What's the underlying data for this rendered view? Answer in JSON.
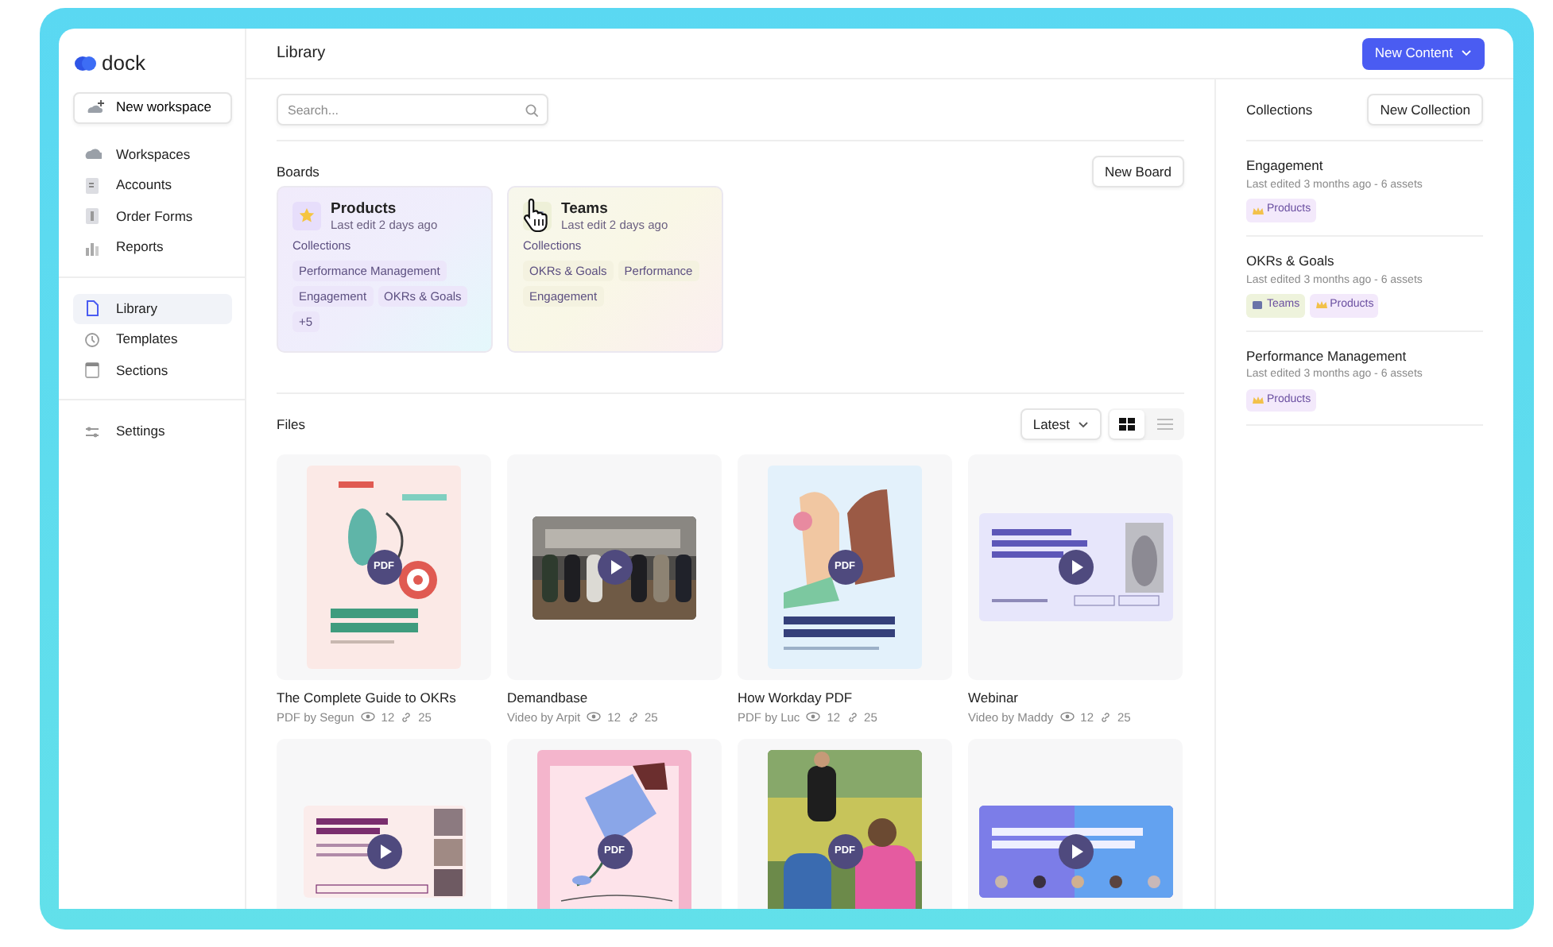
{
  "sidebar": {
    "logo": "dock",
    "new_workspace": "New workspace",
    "groups": [
      [
        {
          "label": "Workspaces",
          "kind": "workspaces",
          "selected": false
        },
        {
          "label": "Accounts",
          "kind": "accounts",
          "selected": false
        },
        {
          "label": "Order Forms",
          "kind": "orders",
          "selected": false
        },
        {
          "label": "Reports",
          "kind": "reports",
          "selected": false
        }
      ],
      [
        {
          "label": "Library",
          "kind": "library",
          "selected": true
        },
        {
          "label": "Templates",
          "kind": "templates",
          "selected": false
        },
        {
          "label": "Sections",
          "kind": "sections",
          "selected": false
        }
      ],
      [
        {
          "label": "Settings",
          "kind": "settings",
          "selected": false
        }
      ]
    ]
  },
  "header": {
    "title": "Library",
    "new_content": "New Content"
  },
  "search": {
    "placeholder": "Search..."
  },
  "boards": {
    "title": "Boards",
    "new_board": "New Board",
    "items": [
      {
        "kind": "products",
        "name": "Products",
        "meta": "Last edit 2 days ago",
        "collections_label": "Collections",
        "tags": [
          "Performance Management",
          "Engagement",
          "OKRs & Goals",
          "+5"
        ]
      },
      {
        "kind": "teams",
        "name": "Teams",
        "meta": "Last edit 2 days ago",
        "collections_label": "Collections",
        "tags": [
          "OKRs & Goals",
          "Performance",
          "Engagement"
        ]
      }
    ]
  },
  "files": {
    "title": "Files",
    "sort": "Latest",
    "views": [
      {
        "kind": "grid",
        "selected": true
      },
      {
        "kind": "list",
        "selected": false
      }
    ],
    "items": [
      {
        "kind": "pdf",
        "badge": "PDF",
        "title": "The Complete Guide to OKRs",
        "by": "PDF by Segun",
        "views": "12",
        "links": "25"
      },
      {
        "kind": "video",
        "title": "Demandbase",
        "by": "Video by Arpit",
        "views": "12",
        "links": "25"
      },
      {
        "kind": "pdf",
        "badge": "PDF",
        "title": "How Workday PDF",
        "by": "PDF by Luc",
        "views": "12",
        "links": "25"
      },
      {
        "kind": "video",
        "title": "Webinar",
        "by": "Video by Maddy",
        "views": "12",
        "links": "25"
      },
      {
        "kind": "video"
      },
      {
        "kind": "pdf",
        "badge": "PDF"
      },
      {
        "kind": "pdf",
        "badge": "PDF"
      },
      {
        "kind": "video"
      }
    ]
  },
  "collections": {
    "title": "Collections",
    "new_collection": "New Collection",
    "items": [
      {
        "name": "Engagement",
        "meta": "Last edited 3 months ago - 6 assets",
        "tags": [
          {
            "kind": "products",
            "label": "Products"
          }
        ]
      },
      {
        "name": "OKRs & Goals",
        "meta": "Last edited 3 months ago - 6 assets",
        "tags": [
          {
            "kind": "teams",
            "label": "Teams"
          },
          {
            "kind": "products",
            "label": "Products"
          }
        ]
      },
      {
        "name": "Performance Management",
        "meta": "Last edited 3 months ago - 6 assets",
        "tags": [
          {
            "kind": "products",
            "label": "Products"
          }
        ]
      }
    ]
  }
}
